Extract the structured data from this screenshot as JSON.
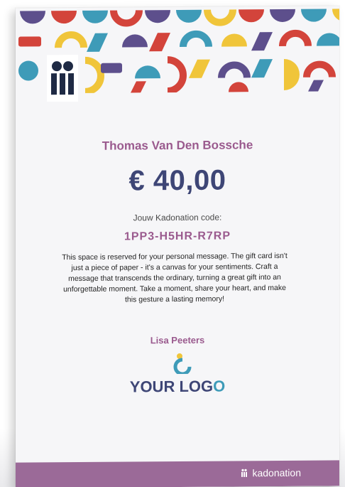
{
  "gift_card": {
    "recipient_name": "Thomas Van Den Bossche",
    "amount": "€ 40,00",
    "code_label": "Jouw Kadonation code:",
    "code": "1PP3-H5HR-R7RP",
    "message": "This space is reserved for your personal message. The gift card isn't just a piece of paper - it's a canvas for your sentiments. Craft a message that transcends the ordinary, turning a great gift into an unforgettable moment. Take a moment, share your heart, and make this gesture a lasting memory!",
    "sender_name": "Lisa Peeters",
    "logo_text_start": "YOUR LOG",
    "logo_text_end": "O"
  },
  "footer": {
    "brand": "kadonation"
  },
  "colors": {
    "accent_purple": "#9a5a8e",
    "navy": "#3e4676",
    "teal": "#3e9bb8",
    "yellow": "#f0c53a",
    "red": "#d3443b",
    "footer_bg": "#9b6a98"
  },
  "icons": [
    "kadonation-gift-icon",
    "your-logo-mark-icon",
    "kadonation-mini-icon"
  ]
}
